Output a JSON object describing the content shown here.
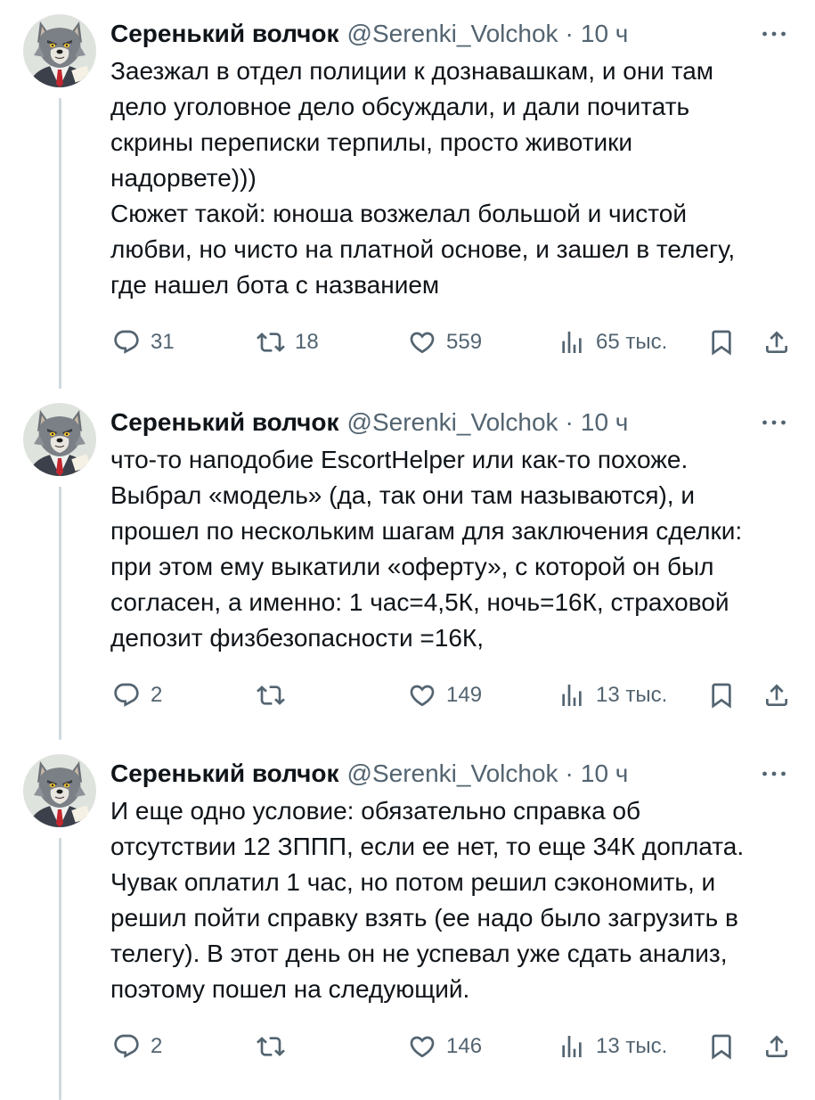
{
  "colors": {
    "text": "#0f1419",
    "secondary": "#536471",
    "thread_line": "#cfd9de",
    "background": "#ffffff"
  },
  "icons": {
    "avatar": "wolf-in-suit-avatar",
    "more": "more-icon",
    "reply": "reply-icon",
    "retweet": "retweet-icon",
    "like": "heart-icon",
    "views": "views-bar-chart-icon",
    "bookmark": "bookmark-icon",
    "share": "share-icon"
  },
  "thread": {
    "tweets": [
      {
        "author": {
          "name": "Серенький волчок",
          "handle": "@Serenki_Volchok",
          "separator": "·",
          "time": "10 ч"
        },
        "lines": [
          "Заезжал в отдел полиции к дознавашкам, и они там",
          "дело уголовное дело обсуждали, и дали почитать",
          "скрины переписки терпилы, просто животики",
          "надорвете)))",
          "Сюжет такой: юноша возжелал большой и чистой",
          "любви, но чисто на платной основе, и зашел в телегу,",
          "где нашел бота с названием"
        ],
        "stats": {
          "replies": "31",
          "retweets": "18",
          "likes": "559",
          "views": "65 тыс."
        }
      },
      {
        "author": {
          "name": "Серенький волчок",
          "handle": "@Serenki_Volchok",
          "separator": "·",
          "time": "10 ч"
        },
        "lines": [
          "что-то наподобие EscortHelper или как-то похоже.",
          "Выбрал «модель» (да, так они там называются), и",
          "прошел по нескольким шагам для заключения сделки:",
          "при этом ему выкатили «оферту», с которой он был",
          "согласен, а именно: 1 час=4,5К, ночь=16К, страховой",
          "депозит физбезопасности =16К,"
        ],
        "stats": {
          "replies": "2",
          "likes": "149",
          "views": "13 тыс."
        }
      },
      {
        "author": {
          "name": "Серенький волчок",
          "handle": "@Serenki_Volchok",
          "separator": "·",
          "time": "10 ч"
        },
        "lines": [
          "И еще одно условие: обязательно справка об",
          "отсутствии 12 ЗППП, если ее нет, то еще 34К доплата.",
          "Чувак оплатил 1 час, но потом решил сэкономить, и",
          "решил пойти справку взять (ее надо было загрузить в",
          "телегу). В этот день он не успевал уже сдать анализ,",
          "поэтому пошел на следующий."
        ],
        "stats": {
          "replies": "2",
          "likes": "146",
          "views": "13 тыс."
        }
      }
    ]
  }
}
